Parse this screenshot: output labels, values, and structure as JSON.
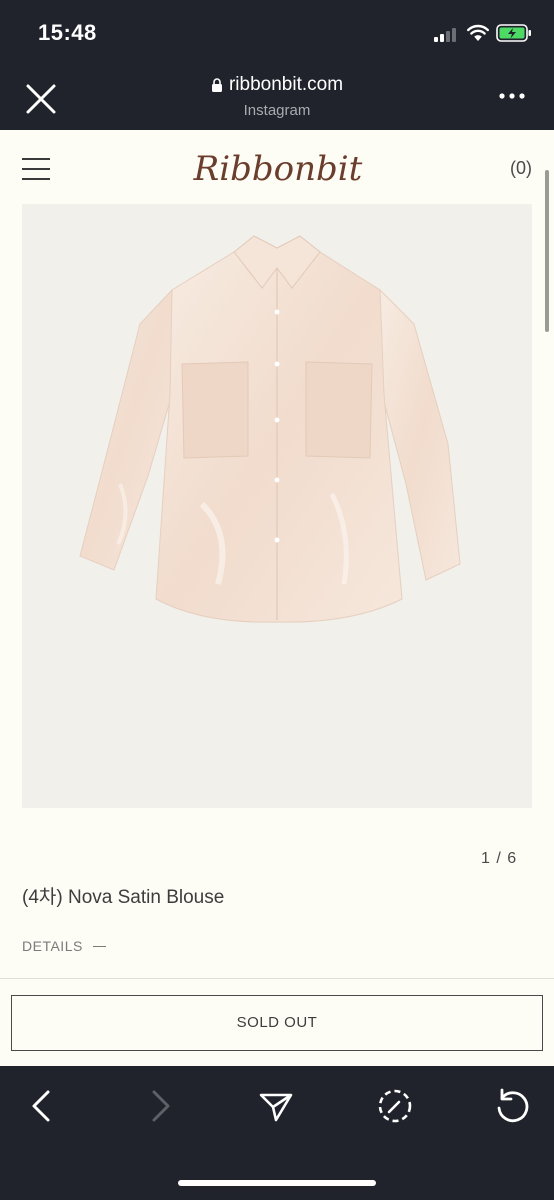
{
  "status_bar": {
    "time": "15:48"
  },
  "browser": {
    "url": "ribbonbit.com",
    "source": "Instagram"
  },
  "site": {
    "logo_text": "Ribbonbit",
    "cart_label": "(0)"
  },
  "product": {
    "image_counter": "1 / 6",
    "title": "(4차) Nova Satin Blouse",
    "details_label": "DETAILS",
    "buy_button_label": "SOLD OUT"
  },
  "colors": {
    "page_bg": "#fdfcf5",
    "chrome_bg": "#20232b",
    "blouse": "#f4e3d6",
    "battery_green": "#4cd964"
  },
  "icons": [
    "signal-icon",
    "wifi-icon",
    "battery-icon",
    "close-icon",
    "lock-icon",
    "more-icon",
    "menu-icon",
    "back-icon",
    "forward-icon",
    "share-icon",
    "compass-icon",
    "reload-icon"
  ]
}
